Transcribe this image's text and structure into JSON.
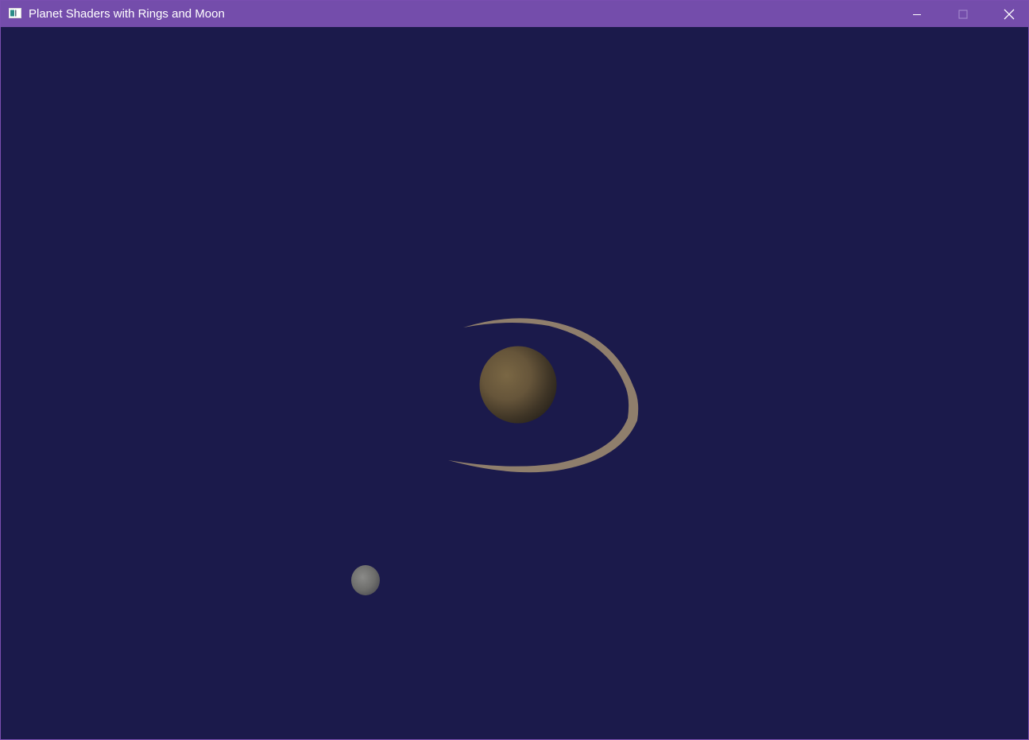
{
  "window": {
    "title": "Planet Shaders with Rings and Moon",
    "title_bar_color": "#744dab",
    "background_color": "#1b1a4b"
  },
  "caption_buttons": {
    "minimize_icon": "minimize-icon",
    "maximize_icon": "maximize-icon",
    "close_icon": "close-icon"
  },
  "scene": {
    "planet_color": "#6b5a3a",
    "ring_color": "#8f7e6c",
    "moon_color": "#7a7a7a"
  }
}
